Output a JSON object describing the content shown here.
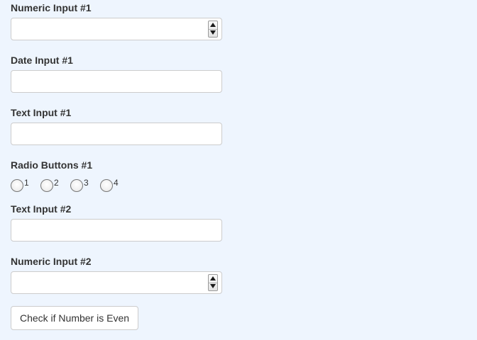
{
  "form": {
    "numeric_input_1": {
      "label": "Numeric Input #1",
      "value": ""
    },
    "date_input_1": {
      "label": "Date Input #1",
      "value": ""
    },
    "text_input_1": {
      "label": "Text Input #1",
      "value": ""
    },
    "radio_buttons_1": {
      "label": "Radio Buttons #1",
      "options": [
        "1",
        "2",
        "3",
        "4"
      ],
      "selected": null
    },
    "text_input_2": {
      "label": "Text Input #2",
      "value": ""
    },
    "numeric_input_2": {
      "label": "Numeric Input #2",
      "value": ""
    },
    "check_button_label": "Check if Number is Even"
  },
  "icons": {
    "spinner_up": "triangle-up-icon",
    "spinner_down": "triangle-down-icon"
  },
  "colors": {
    "background": "#eef5fe",
    "input_border": "#cccccc",
    "text": "#333333"
  }
}
